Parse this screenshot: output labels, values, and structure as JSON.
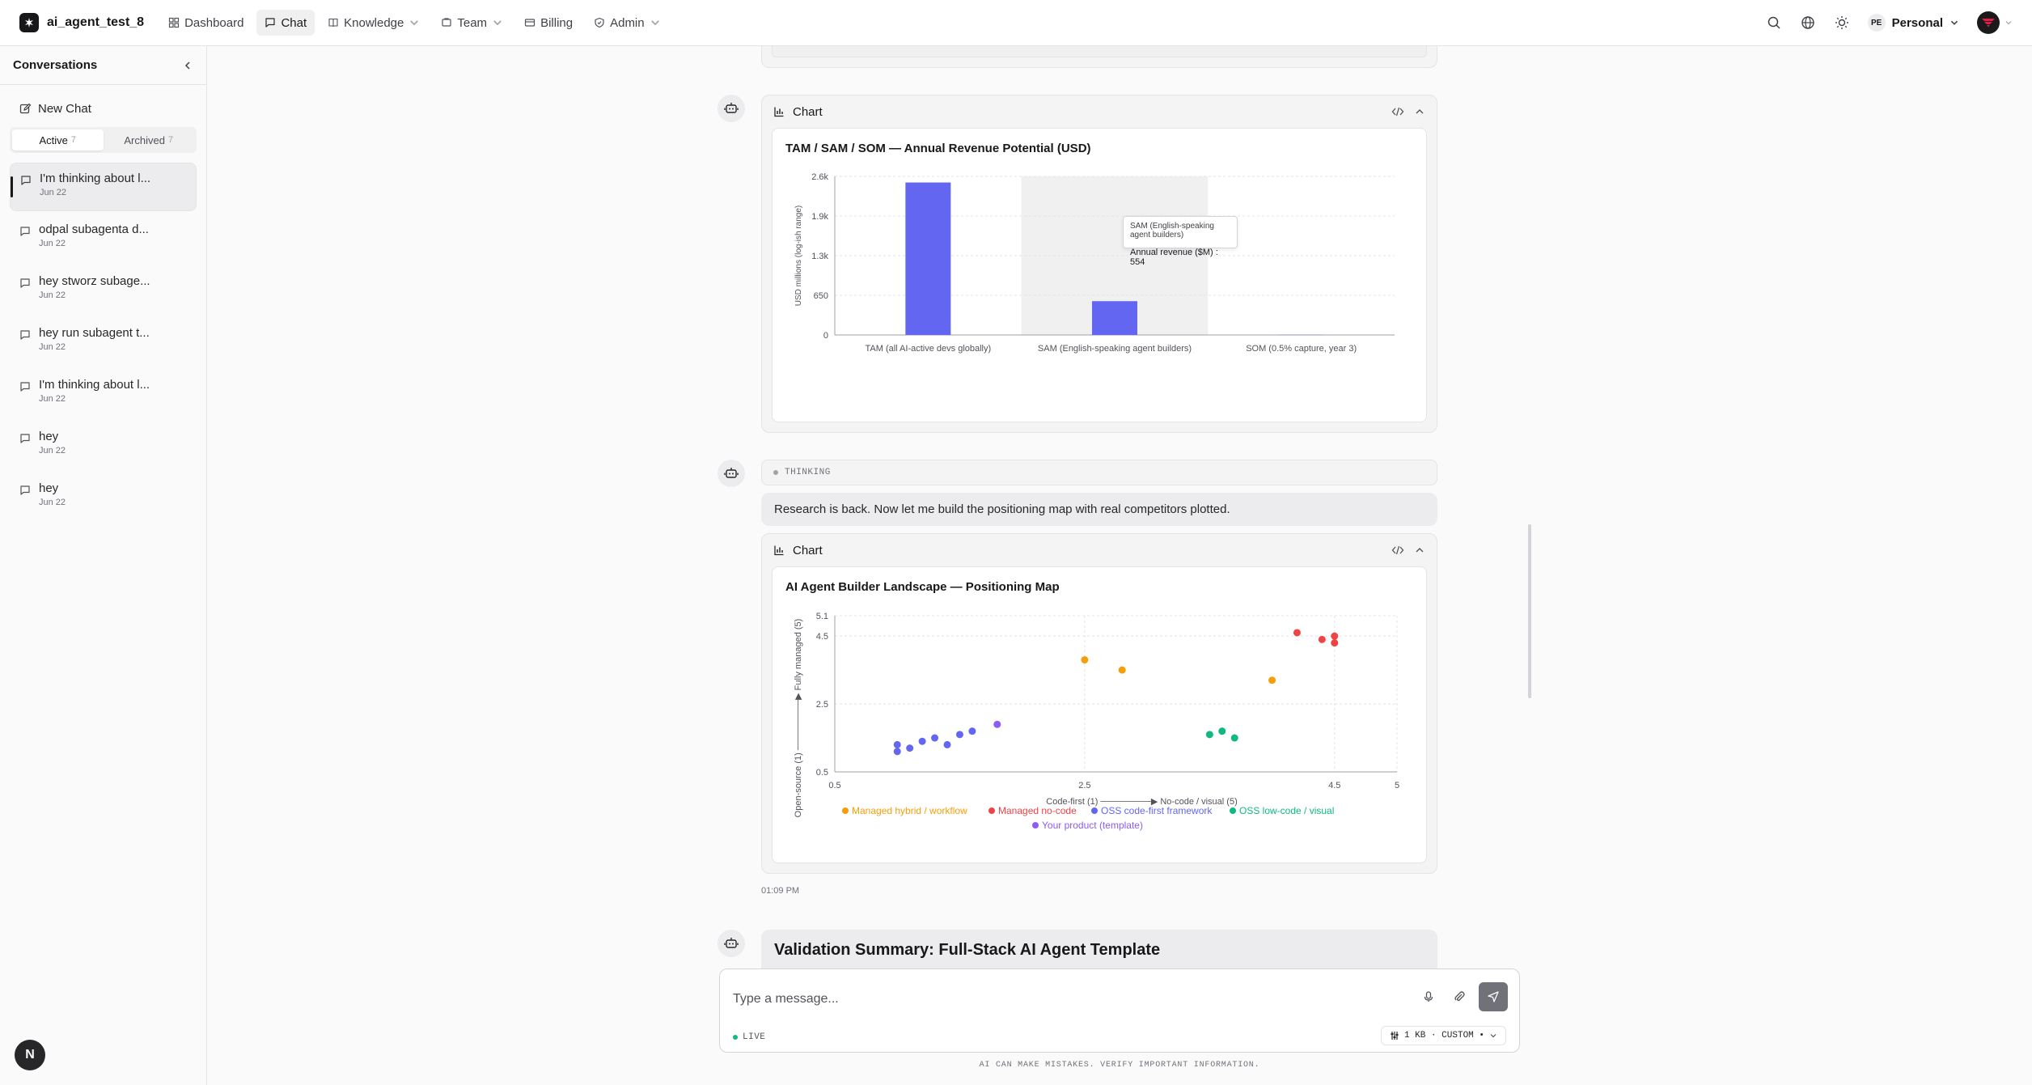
{
  "header": {
    "app_name": "ai_agent_test_8",
    "nav": [
      {
        "label": "Dashboard",
        "icon": "dashboard-icon"
      },
      {
        "label": "Chat",
        "icon": "chat-icon"
      },
      {
        "label": "Knowledge",
        "icon": "book-icon"
      },
      {
        "label": "Team",
        "icon": "team-icon"
      },
      {
        "label": "Billing",
        "icon": "card-icon"
      },
      {
        "label": "Admin",
        "icon": "shield-icon"
      }
    ],
    "workspace_badge": "PE",
    "workspace": "Personal"
  },
  "sidebar": {
    "title": "Conversations",
    "new_chat": "New Chat",
    "tabs": [
      {
        "label": "Active",
        "count": "7"
      },
      {
        "label": "Archived",
        "count": "7"
      }
    ],
    "conversations": [
      {
        "title": "I'm thinking about l...",
        "date": "Jun 22"
      },
      {
        "title": "odpal subagenta d...",
        "date": "Jun 22"
      },
      {
        "title": "hey stworz subage...",
        "date": "Jun 22"
      },
      {
        "title": "hey run subagent t...",
        "date": "Jun 22"
      },
      {
        "title": "I'm thinking about l...",
        "date": "Jun 22"
      },
      {
        "title": "hey",
        "date": "Jun 22"
      },
      {
        "title": "hey",
        "date": "Jun 22"
      }
    ],
    "user_initial": "N"
  },
  "chat": {
    "card_label": "Chart",
    "thinking_label": "THINKING",
    "message": "Research is back. Now let me build the positioning map with real competitors plotted.",
    "timestamp": "01:09 PM",
    "summary_title": "Validation Summary: Full-Stack AI Agent Template"
  },
  "tooltip": {
    "title": "SAM (English-speaking agent builders)",
    "value": "Annual revenue ($M) : 554"
  },
  "input": {
    "placeholder": "Type a message...",
    "live": "LIVE",
    "model": "1 KB · CUSTOM •",
    "disclaimer": "AI CAN MAKE MISTAKES. VERIFY IMPORTANT INFORMATION."
  },
  "colors": {
    "accent": "#6366f1",
    "orange": "#f59e0b",
    "red": "#ef4444",
    "blue": "#6366f1",
    "green": "#10b981",
    "purple": "#8b5cf6"
  },
  "chart_data": [
    {
      "type": "bar",
      "title": "TAM / SAM / SOM — Annual Revenue Potential (USD)",
      "categories": [
        "TAM (all AI-active devs globally)",
        "SAM (English-speaking agent builders)",
        "SOM (0.5% capture, year 3)"
      ],
      "values": [
        2500,
        554,
        3
      ],
      "ylabel": "USD millions (log-ish range)",
      "series_name": "Annual revenue ($M)",
      "yticks": [
        "0",
        "650",
        "1.3k",
        "1.9k",
        "2.6k"
      ],
      "ylim": [
        0,
        2600
      ],
      "grid": true,
      "highlighted_category": 1
    },
    {
      "type": "scatter",
      "title": "AI Agent Builder Landscape — Positioning Map",
      "xlabel": "Code-first (1) ────────▶ No-code / visual (5)",
      "ylabel": "Open-source (1) ────────▶ Fully managed (5)",
      "xlim": [
        0.5,
        5
      ],
      "ylim": [
        0.5,
        5.1
      ],
      "xticks": [
        "0.5",
        "2.5",
        "4.5",
        "5"
      ],
      "yticks": [
        "0.5",
        "2.5",
        "4.5",
        "5.1"
      ],
      "grid": true,
      "legend": "bottom",
      "series": [
        {
          "name": "Managed hybrid / workflow",
          "points": [
            [
              2.5,
              3.8
            ],
            [
              2.8,
              3.5
            ],
            [
              4.0,
              3.2
            ]
          ]
        },
        {
          "name": "Managed no-code",
          "points": [
            [
              4.2,
              4.6
            ],
            [
              4.4,
              4.4
            ],
            [
              4.5,
              4.5
            ],
            [
              4.5,
              4.3
            ]
          ]
        },
        {
          "name": "OSS code-first framework",
          "points": [
            [
              1.0,
              1.1
            ],
            [
              1.0,
              1.3
            ],
            [
              1.1,
              1.2
            ],
            [
              1.2,
              1.4
            ],
            [
              1.3,
              1.5
            ],
            [
              1.4,
              1.3
            ],
            [
              1.5,
              1.6
            ],
            [
              1.6,
              1.7
            ]
          ]
        },
        {
          "name": "OSS low-code / visual",
          "points": [
            [
              3.5,
              1.6
            ],
            [
              3.6,
              1.7
            ],
            [
              3.7,
              1.5
            ]
          ]
        },
        {
          "name": "Your product (template)",
          "points": [
            [
              1.8,
              1.9
            ]
          ]
        }
      ]
    }
  ]
}
